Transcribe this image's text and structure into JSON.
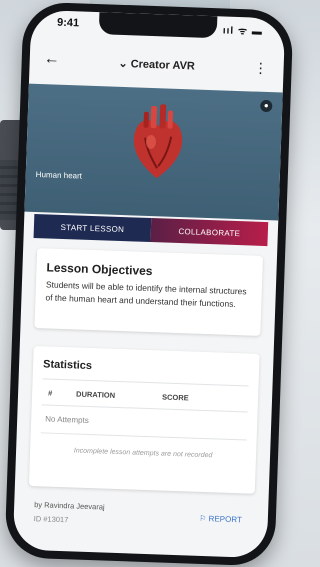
{
  "status_bar": {
    "time": "9:41",
    "icons": "ııl ᯤ ▬"
  },
  "app_bar": {
    "back_icon": "←",
    "title": "⌄ Creator AVR",
    "more_icon": "⋮"
  },
  "hero": {
    "caption": "Human heart",
    "user_icon": "●"
  },
  "actions": {
    "start_lesson": "START LESSON",
    "collaborate": "COLLABORATE"
  },
  "objectives": {
    "heading": "Lesson Objectives",
    "text": "Students will be able to identify the internal structures of the human heart and understand their functions."
  },
  "statistics": {
    "heading": "Statistics",
    "columns": [
      "#",
      "DURATION",
      "SCORE"
    ],
    "empty": "No Attempts",
    "note": "Incomplete lesson attempts are not recorded"
  },
  "footer": {
    "author": "by Ravindra Jeevaraj",
    "id": "ID #13017",
    "report": "⚐ REPORT"
  },
  "colors": {
    "hero": "#4d6f85",
    "start_button": "#1e2a52",
    "collaborate_button": "#b81e4a",
    "link": "#3b73c9"
  }
}
